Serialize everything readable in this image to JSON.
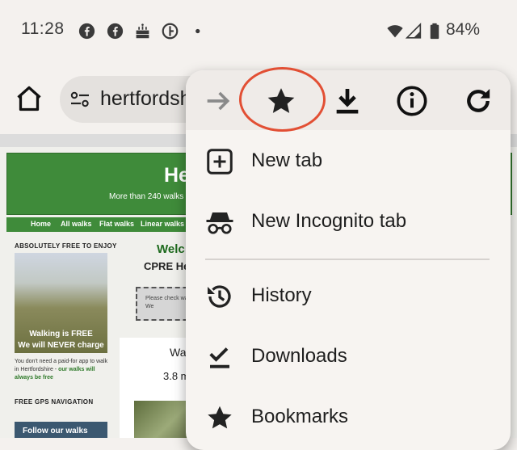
{
  "status_bar": {
    "time": "11:28",
    "notification_icons": [
      "facebook-icon",
      "facebook-icon",
      "birthday-cake-icon",
      "app-g-icon",
      "more-dot-icon"
    ],
    "battery_percent": "84%"
  },
  "toolbar": {
    "url": "hertfordshirewalker.org.uk"
  },
  "webpage": {
    "banner_title": "He",
    "banner_subtitle": "More than 240 walks in",
    "nav": [
      "Home",
      "All walks",
      "Flat walks",
      "Linear walks"
    ],
    "sidebar_heading_1": "ABSOLUTELY FREE TO ENJOY",
    "photo_caption_1": "Walking is FREE",
    "photo_caption_2": "We will NEVER charge",
    "free_text_plain": "You don't need a paid-for app to walk in Hertfordshire - ",
    "free_text_bold": "our walks will always be free",
    "sidebar_heading_2": "FREE GPS NAVIGATION",
    "gps_caption": "Follow our walks",
    "welcome": "Welc",
    "cpre": "CPRE He",
    "notice": "Please check walk. We",
    "walk_title": "Wa",
    "walk_distance": "3.8 m"
  },
  "menu": {
    "top_actions": [
      "forward-icon",
      "bookmark-star-icon",
      "download-icon",
      "info-icon",
      "refresh-icon"
    ],
    "items": [
      {
        "label": "New tab",
        "icon": "new-tab-icon"
      },
      {
        "label": "New Incognito tab",
        "icon": "incognito-icon"
      },
      {
        "label": "History",
        "icon": "history-icon"
      },
      {
        "label": "Downloads",
        "icon": "downloads-icon"
      },
      {
        "label": "Bookmarks",
        "icon": "bookmarks-icon"
      }
    ]
  },
  "colors": {
    "accent_green": "#3f8b3a",
    "highlight_red": "#e24f34"
  }
}
